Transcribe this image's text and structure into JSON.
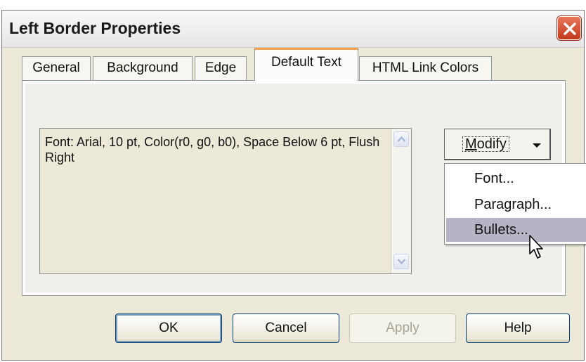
{
  "dialog": {
    "title": "Left Border Properties"
  },
  "tabs": [
    {
      "label": "General",
      "active": false
    },
    {
      "label": "Background",
      "active": false
    },
    {
      "label": "Edge",
      "active": false
    },
    {
      "label": "Default Text",
      "active": true
    },
    {
      "label": "HTML Link Colors",
      "active": false
    }
  ],
  "text_description": "Font:  Arial, 10 pt, Color(r0, g0, b0), Space Below 6 pt, Flush Right",
  "modify": {
    "label_underlined": "M",
    "label_rest": "odify"
  },
  "menu": {
    "items": [
      "Font...",
      "Paragraph...",
      "Bullets..."
    ],
    "highlighted": "Bullets..."
  },
  "buttons": {
    "ok": "OK",
    "cancel": "Cancel",
    "apply": "Apply",
    "help": "Help"
  },
  "colors": {
    "close_button": "#c2391c",
    "active_tab_accent": "#f7a14a",
    "menu_highlight": "#b5b4c4"
  },
  "icons": [
    "close-icon",
    "scroll-up-icon",
    "scroll-down-icon",
    "dropdown-arrow-icon",
    "mouse-pointer-icon"
  ]
}
